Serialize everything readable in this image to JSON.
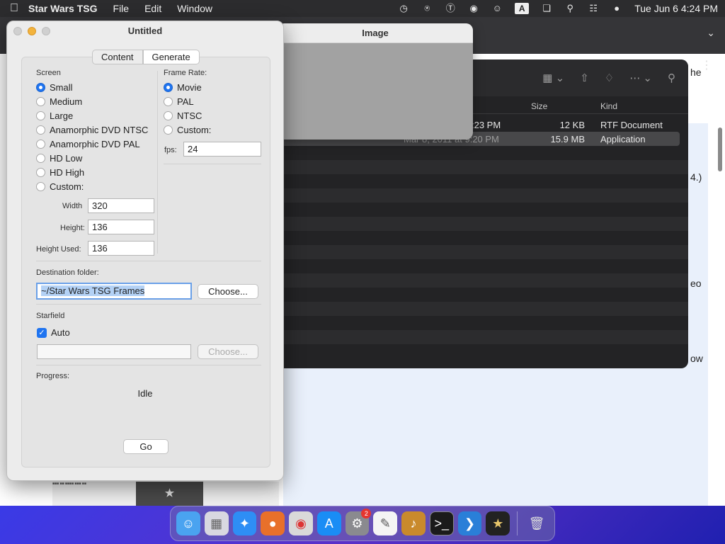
{
  "menubar": {
    "app_name": "Star Wars TSG",
    "items": [
      "File",
      "Edit",
      "Window"
    ],
    "clock": "Tue Jun 6  4:24 PM",
    "input_indicator": "A"
  },
  "browser_snippets": {
    "s1": "he",
    "s2": "4.)",
    "s3": "eo",
    "s4": "ow"
  },
  "finder": {
    "columns": {
      "size": "Size",
      "kind": "Kind"
    },
    "rows": [
      {
        "date": ":23 PM",
        "size": "12 KB",
        "kind": "RTF Document"
      },
      {
        "date": "Mar 8, 2011 at 9:20 PM",
        "size": "15.9 MB",
        "kind": "Application"
      }
    ]
  },
  "image_window": {
    "title": "Image"
  },
  "tsg_window": {
    "title": "Untitled",
    "tabs": [
      "Content",
      "Generate"
    ],
    "screen": {
      "label": "Screen",
      "options": [
        "Small",
        "Medium",
        "Large",
        "Anamorphic DVD NTSC",
        "Anamorphic DVD PAL",
        "HD Low",
        "HD High",
        "Custom:"
      ],
      "selected": "Small",
      "width_label": "Width",
      "width": "320",
      "height_label": "Height:",
      "height": "136",
      "height_used_label": "Height Used:",
      "height_used": "136"
    },
    "frame_rate": {
      "label": "Frame Rate:",
      "options": [
        "Movie",
        "PAL",
        "NTSC",
        "Custom:"
      ],
      "selected": "Movie",
      "fps_label": "fps:",
      "fps": "24"
    },
    "destination": {
      "label": "Destination folder:",
      "value": "~/Star Wars TSG Frames",
      "choose_label": "Choose..."
    },
    "starfield": {
      "label": "Starfield",
      "auto_label": "Auto",
      "auto_checked": true,
      "value": "",
      "choose_label": "Choose..."
    },
    "progress": {
      "label": "Progress:",
      "status": "Idle"
    },
    "go_label": "Go"
  }
}
